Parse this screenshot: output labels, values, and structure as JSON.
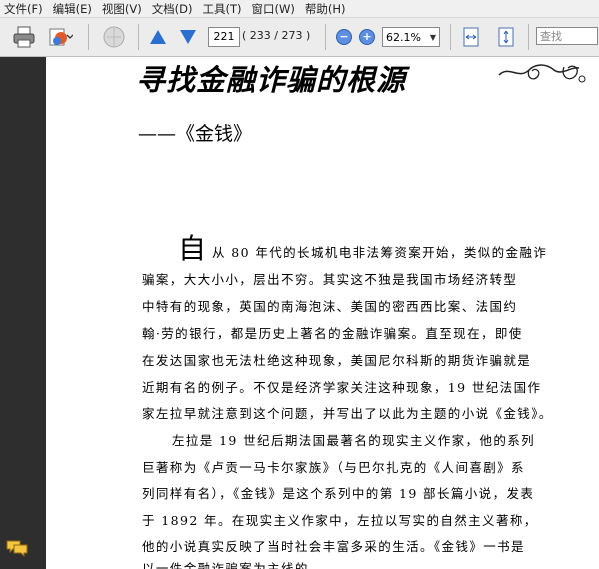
{
  "menu": [
    "文件(F)",
    "编辑(E)",
    "视图(V)",
    "文档(D)",
    "工具(T)",
    "窗口(W)",
    "帮助(H)"
  ],
  "toolbar": {
    "page_current": "221",
    "page_of": "( 233 / 273 )",
    "zoom_value": "62.1%",
    "search_placeholder": "查找"
  },
  "document": {
    "title": "寻找金融诈骗的根源",
    "subtitle": "——《金钱》",
    "dropcap": "自",
    "lines": [
      "从 80 年代的长城机电非法筹资案开始，类似的金融诈",
      "骗案，大大小小，层出不穷。其实这不独是我国市场经济转型",
      "中特有的现象，英国的南海泡沫、美国的密西西比案、法国约",
      "翰·劳的银行，都是历史上著名的金融诈骗案。直至现在，即使",
      "在发达国家也无法杜绝这种现象，美国尼尔科斯的期货诈骗就是",
      "近期有名的例子。不仅是经济学家关注这种现象，19 世纪法国作",
      "家左拉早就注意到这个问题，并写出了以此为主题的小说《金钱》。",
      "左拉是 19 世纪后期法国最著名的现实主义作家，他的系列",
      "巨著称为《卢贡一马卡尔家族》（与巴尔扎克的《人间喜剧》系",
      "列同样有名），《金钱》是这个系列中的第 19 部长篇小说，发表",
      "于 1892 年。在现实主义作家中，左拉以写实的自然主义著称，",
      "他的小说真实反映了当时社会丰富多采的生活。《金钱》一书是",
      "以一件金融诈骗案为主线的。"
    ]
  }
}
